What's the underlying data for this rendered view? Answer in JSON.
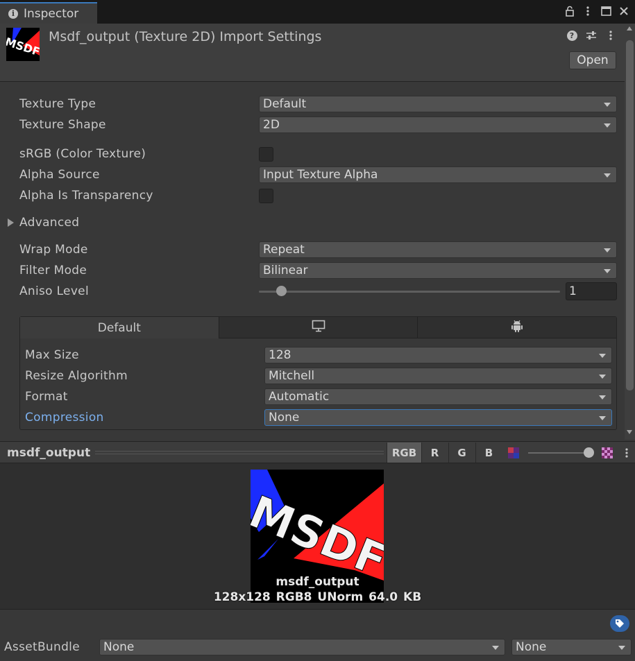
{
  "window": {
    "tab_label": "Inspector"
  },
  "header": {
    "title": "Msdf_output (Texture 2D) Import Settings",
    "open_label": "Open",
    "thumb_text": "MSDF"
  },
  "fields": {
    "texture_type": {
      "label": "Texture Type",
      "value": "Default"
    },
    "texture_shape": {
      "label": "Texture Shape",
      "value": "2D"
    },
    "srgb": {
      "label": "sRGB (Color Texture)",
      "checked": false
    },
    "alpha_source": {
      "label": "Alpha Source",
      "value": "Input Texture Alpha"
    },
    "alpha_transparency": {
      "label": "Alpha Is Transparency",
      "checked": false
    },
    "advanced": {
      "label": "Advanced"
    },
    "wrap_mode": {
      "label": "Wrap Mode",
      "value": "Repeat"
    },
    "filter_mode": {
      "label": "Filter Mode",
      "value": "Bilinear"
    },
    "aniso_level": {
      "label": "Aniso Level",
      "value": "1"
    }
  },
  "platform": {
    "tabs": [
      {
        "label": "Default",
        "icon": ""
      },
      {
        "label": "",
        "icon": "monitor-icon"
      },
      {
        "label": "",
        "icon": "android-icon"
      }
    ],
    "max_size": {
      "label": "Max Size",
      "value": "128"
    },
    "resize": {
      "label": "Resize Algorithm",
      "value": "Mitchell"
    },
    "format": {
      "label": "Format",
      "value": "Automatic"
    },
    "compression": {
      "label": "Compression",
      "value": "None"
    }
  },
  "preview": {
    "title": "msdf_output",
    "channels": [
      "RGB",
      "R",
      "G",
      "B"
    ],
    "caption_name": "msdf_output",
    "caption_info": "128x128  RGB8 UNorm   64.0 KB",
    "image_text": "MSDF"
  },
  "footer": {
    "assetbundle_label": "AssetBundle",
    "bundle_value": "None",
    "variant_value": "None"
  },
  "colors": {
    "accent": "#3a79bb",
    "highlight_label": "#7cb0ee"
  }
}
